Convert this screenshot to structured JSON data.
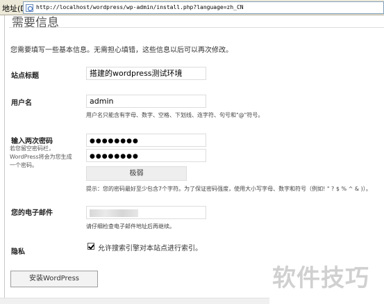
{
  "addressbar": {
    "label": "地址(D)",
    "url": "http://localhost/wordpress/wp-admin/install.php?language=zh_CN"
  },
  "page": {
    "heading": "需要信息",
    "intro": "您需要填写一些基本信息。无需担心填错，这些信息以后可以再次修改。"
  },
  "form": {
    "site_title": {
      "label": "站点标题",
      "value": "搭建的wordpress测试环境"
    },
    "username": {
      "label": "用户名",
      "value": "admin",
      "note": "用户名只能含有字母、数字、空格、下划线、连字符、句号和\"@\"符号。"
    },
    "password": {
      "label": "输入两次密码",
      "sub_note": "若您留空密码栏，WordPress将会为您生成一个密码。",
      "value1": "●●●●●●●●",
      "value2": "●●●●●●●●",
      "strength": "极弱",
      "hint": "提示：您的密码最好至少包含7个字符。为了保证密码强度，使用大小写字母、数字和符号（例如! \" ? $ % ^ & )）。"
    },
    "email": {
      "label": "您的电子邮件",
      "note": "请仔细检查电子邮件地址后再继续。"
    },
    "privacy": {
      "label": "隐私",
      "checkbox_label": "允许搜索引擎对本站点进行索引。",
      "checked": true
    },
    "install_button": "安装WordPress"
  },
  "watermark": "软件技巧"
}
